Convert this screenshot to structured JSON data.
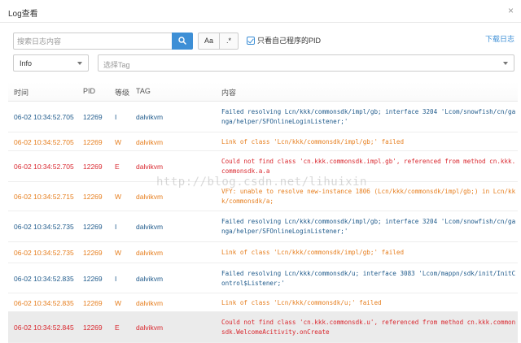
{
  "window": {
    "title": "Log查看",
    "close_glyph": "×"
  },
  "toolbar": {
    "search_placeholder": "搜索日志内容",
    "search_icon": "search-icon",
    "case_label": "Aa",
    "regex_label": ".*",
    "own_pid_label": "只看自己程序的PID",
    "own_pid_checked": true,
    "download_label": "下载日志"
  },
  "filters": {
    "level_value": "Info",
    "tag_placeholder": "选择Tag"
  },
  "table": {
    "columns": {
      "time": "时间",
      "pid": "PID",
      "level": "等级",
      "tag": "TAG",
      "message": "内容"
    },
    "rows": [
      {
        "time": "06-02 10:34:52.705",
        "pid": "12269",
        "level": "I",
        "tag": "dalvikvm",
        "message": "Failed resolving Lcn/kkk/commonsdk/impl/gb; interface 3204 'Lcom/snowfish/cn/ganga/helper/SFOnlineLoginListener;'"
      },
      {
        "time": "06-02 10:34:52.705",
        "pid": "12269",
        "level": "W",
        "tag": "dalvikvm",
        "message": "Link of class 'Lcn/kkk/commonsdk/impl/gb;' failed"
      },
      {
        "time": "06-02 10:34:52.705",
        "pid": "12269",
        "level": "E",
        "tag": "dalvikvm",
        "message": "Could not find class 'cn.kkk.commonsdk.impl.gb', referenced from method cn.kkk.commonsdk.a.a"
      },
      {
        "time": "06-02 10:34:52.715",
        "pid": "12269",
        "level": "W",
        "tag": "dalvikvm",
        "message": "VFY: unable to resolve new-instance 1806 (Lcn/kkk/commonsdk/impl/gb;) in Lcn/kkk/commonsdk/a;"
      },
      {
        "time": "06-02 10:34:52.735",
        "pid": "12269",
        "level": "I",
        "tag": "dalvikvm",
        "message": "Failed resolving Lcn/kkk/commonsdk/impl/gb; interface 3204 'Lcom/snowfish/cn/ganga/helper/SFOnlineLoginListener;'"
      },
      {
        "time": "06-02 10:34:52.735",
        "pid": "12269",
        "level": "W",
        "tag": "dalvikvm",
        "message": "Link of class 'Lcn/kkk/commonsdk/impl/gb;' failed"
      },
      {
        "time": "06-02 10:34:52.835",
        "pid": "12269",
        "level": "I",
        "tag": "dalvikvm",
        "message": "Failed resolving Lcn/kkk/commonsdk/u; interface 3083 'Lcom/mappn/sdk/init/InitControl$Listener;'"
      },
      {
        "time": "06-02 10:34:52.835",
        "pid": "12269",
        "level": "W",
        "tag": "dalvikvm",
        "message": "Link of class 'Lcn/kkk/commonsdk/u;' failed"
      },
      {
        "time": "06-02 10:34:52.845",
        "pid": "12269",
        "level": "E",
        "tag": "dalvikvm",
        "message": "Could not find class 'cn.kkk.commonsdk.u', referenced from method cn.kkk.commonsdk.WelcomeAcitivity.onCreate"
      }
    ]
  },
  "watermark": "http://blog.csdn.net/lihuixin",
  "colors": {
    "accent": "#3d8fd6",
    "info": "#1f5a8b",
    "warn": "#e67e1e",
    "error": "#d9282f"
  }
}
